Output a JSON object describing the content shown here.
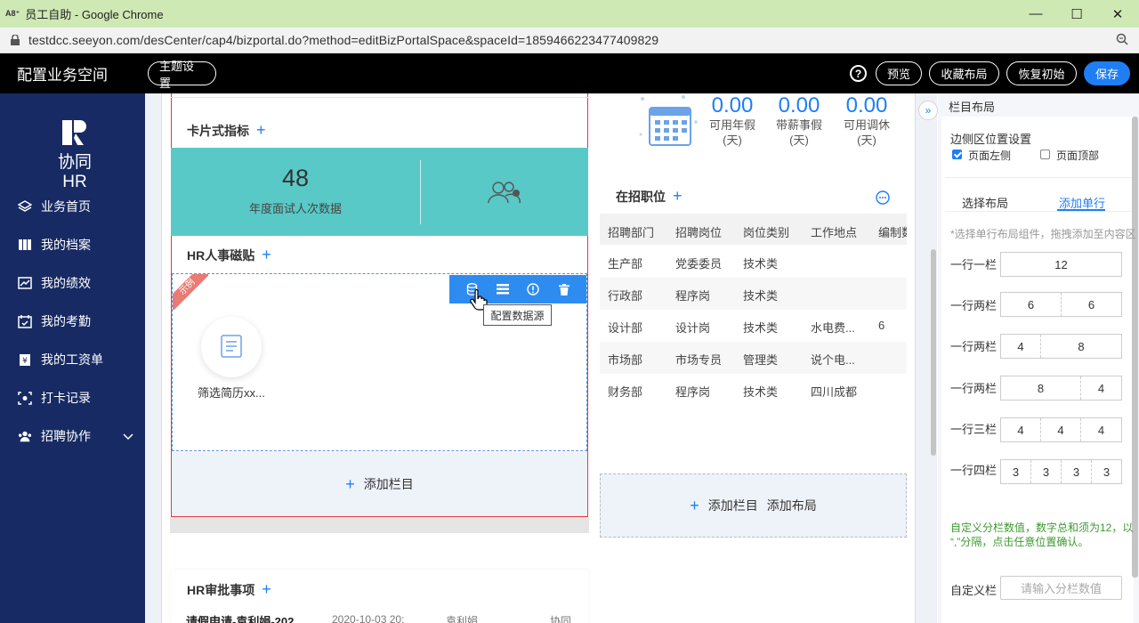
{
  "browser": {
    "app_icon": "A8⁺",
    "title": "员工自助 - Google Chrome",
    "url": "testdcc.seeyon.com/desCenter/cap4/bizportal.do?method=editBizPortalSpace&spaceId=1859466223477409829"
  },
  "header": {
    "title": "配置业务空间",
    "theme_btn": "主题设置",
    "help": "?",
    "preview_btn": "预览",
    "save_layout_btn": "收藏布局",
    "restore_btn": "恢复初始",
    "save_btn": "保存"
  },
  "sidebar": {
    "brand": "协同HR",
    "items": [
      {
        "label": "业务首页",
        "icon": "layers-icon"
      },
      {
        "label": "我的档案",
        "icon": "archive-icon"
      },
      {
        "label": "我的绩效",
        "icon": "chart-icon"
      },
      {
        "label": "我的考勤",
        "icon": "calendar-check-icon"
      },
      {
        "label": "我的工资单",
        "icon": "payslip-icon"
      },
      {
        "label": "打卡记录",
        "icon": "punch-icon"
      },
      {
        "label": "招聘协作",
        "icon": "users-icon"
      }
    ]
  },
  "card_indicators": {
    "title": "卡片式指标",
    "value": "48",
    "label": "年度面试人次数据"
  },
  "hr_stickers": {
    "title": "HR人事磁贴",
    "ribbon": "示例",
    "tooltip": "配置数据源",
    "app_name": "筛选简历xx..."
  },
  "add_column": "添加栏目",
  "approval": {
    "title": "HR审批事项",
    "row": {
      "title": "请假申请-袁利娟-202",
      "date": "2020-10-03 20:",
      "person": "袁利娟",
      "source": "协同"
    }
  },
  "leave": {
    "items": [
      {
        "value": "0.00",
        "label": "可用年假",
        "unit": "(天)"
      },
      {
        "value": "0.00",
        "label": "带薪事假",
        "unit": "(天)"
      },
      {
        "value": "0.00",
        "label": "可用调休",
        "unit": "(天)"
      }
    ]
  },
  "jobs": {
    "title": "在招职位",
    "columns": [
      "招聘部门",
      "招聘岗位",
      "岗位类别",
      "工作地点",
      "编制数"
    ],
    "rows": [
      [
        "生产部",
        "党委委员",
        "技术类",
        "",
        ""
      ],
      [
        "行政部",
        "程序岗",
        "技术类",
        "",
        ""
      ],
      [
        "设计部",
        "设计岗",
        "技术类",
        "水电费...",
        "6"
      ],
      [
        "市场部",
        "市场专员",
        "管理类",
        "说个电...",
        ""
      ],
      [
        "财务部",
        "程序岗",
        "技术类",
        "四川成都",
        ""
      ]
    ]
  },
  "add_layout": {
    "add_column": "添加栏目",
    "add_layout": "添加布局"
  },
  "right_panel": {
    "header": "栏目布局",
    "side_position_title": "边侧区位置设置",
    "opt_left": "页面左侧",
    "opt_top": "页面顶部",
    "tab_select": "选择布局",
    "tab_add": "添加单行",
    "hint": "*选择单行布局组件，拖拽添加至内容区",
    "layouts": [
      {
        "label": "一行一栏",
        "segs": [
          "12"
        ]
      },
      {
        "label": "一行两栏",
        "segs": [
          "6",
          "6"
        ]
      },
      {
        "label": "一行两栏",
        "segs": [
          "4",
          "8"
        ]
      },
      {
        "label": "一行两栏",
        "segs": [
          "8",
          "4"
        ]
      },
      {
        "label": "一行三栏",
        "segs": [
          "4",
          "4",
          "4"
        ]
      },
      {
        "label": "一行四栏",
        "segs": [
          "3",
          "3",
          "3",
          "3"
        ]
      }
    ],
    "custom_note_1": "自定义分栏数值，数字总和须为12，以",
    "custom_note_2": "“,”分隔，点击任意位置确认。",
    "custom_label": "自定义栏",
    "custom_placeholder": "请输入分栏数值"
  },
  "colors": {
    "accent": "#1f7ef4",
    "teal": "#58c9c6",
    "sidebar": "#172a63",
    "ribbon": "#e97b73"
  }
}
